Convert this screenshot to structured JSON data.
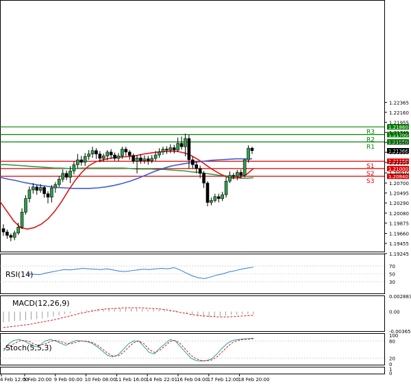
{
  "chart_data": {
    "type": "candlestick",
    "main": {
      "ylim": [
        1.193,
        1.2445
      ],
      "ticks": [
        "1.22365",
        "1.22160",
        "1.21955",
        "1.21745",
        "1.21540",
        "1.21335",
        "1.21125",
        "1.20910",
        "1.20700",
        "1.20495",
        "1.20290",
        "1.20080",
        "1.19875",
        "1.19660",
        "1.19455",
        "1.19245"
      ],
      "levels": [
        {
          "name": "R3",
          "value": 1.2186,
          "label": "1.21860",
          "color": "#008000"
        },
        {
          "name": "R2",
          "value": 1.217,
          "label": "1.21700",
          "color": "#008000"
        },
        {
          "name": "R1",
          "value": 1.2155,
          "label": "1.21550",
          "color": "#008000"
        },
        {
          "name": "S1",
          "value": 1.2115,
          "label": "1.21150",
          "color": "#e00000"
        },
        {
          "name": "S2",
          "value": 1.21,
          "label": "1.21000",
          "color": "#e00000"
        },
        {
          "name": "S3",
          "value": 1.2084,
          "label": "1.20840",
          "color": "#e00000"
        }
      ],
      "current": {
        "value": 1.21366,
        "label": "1.21366"
      },
      "candles": [
        [
          1.1976,
          1.1969,
          1.1985,
          1.1961
        ],
        [
          1.1969,
          1.1962,
          1.1974,
          1.1955
        ],
        [
          1.1962,
          1.1958,
          1.1966,
          1.195
        ],
        [
          1.1958,
          1.1967,
          1.1972,
          1.1952
        ],
        [
          1.1967,
          1.1979,
          1.1988,
          1.1963
        ],
        [
          1.1979,
          1.201,
          1.2018,
          1.1975
        ],
        [
          1.201,
          1.2038,
          1.2045,
          1.2005
        ],
        [
          1.2038,
          1.2056,
          1.2063,
          1.203
        ],
        [
          1.2056,
          1.2062,
          1.207,
          1.2048
        ],
        [
          1.2062,
          1.2055,
          1.2066,
          1.2046
        ],
        [
          1.2055,
          1.2061,
          1.2068,
          1.205
        ],
        [
          1.2061,
          1.2048,
          1.2064,
          1.204
        ],
        [
          1.2048,
          1.2041,
          1.2053,
          1.2028
        ],
        [
          1.2041,
          1.206,
          1.2066,
          1.203
        ],
        [
          1.206,
          1.2067,
          1.2072,
          1.205
        ],
        [
          1.2067,
          1.2078,
          1.2085,
          1.2062
        ],
        [
          1.2078,
          1.209,
          1.2098,
          1.2072
        ],
        [
          1.209,
          1.2082,
          1.2096,
          1.2076
        ],
        [
          1.2082,
          1.2095,
          1.2105,
          1.207
        ],
        [
          1.2095,
          1.2108,
          1.2115,
          1.2088
        ],
        [
          1.2108,
          1.2118,
          1.213,
          1.21
        ],
        [
          1.2118,
          1.2113,
          1.2126,
          1.2106
        ],
        [
          1.2113,
          1.2125,
          1.2132,
          1.2105
        ],
        [
          1.2125,
          1.213,
          1.2138,
          1.2118
        ],
        [
          1.213,
          1.2137,
          1.2145,
          1.2122
        ],
        [
          1.2137,
          1.213,
          1.2142,
          1.212
        ],
        [
          1.213,
          1.2121,
          1.2136,
          1.2113
        ],
        [
          1.2121,
          1.2126,
          1.2131,
          1.2114
        ],
        [
          1.2126,
          1.2134,
          1.2138,
          1.2117
        ],
        [
          1.2134,
          1.2128,
          1.214,
          1.212
        ],
        [
          1.2128,
          1.2121,
          1.2133,
          1.2116
        ],
        [
          1.2121,
          1.2126,
          1.2132,
          1.2115
        ],
        [
          1.2126,
          1.214,
          1.2145,
          1.212
        ],
        [
          1.214,
          1.2134,
          1.2145,
          1.2126
        ],
        [
          1.2134,
          1.2127,
          1.2138,
          1.2118
        ],
        [
          1.2127,
          1.2115,
          1.2131,
          1.211
        ],
        [
          1.2115,
          1.2122,
          1.2128,
          1.209
        ],
        [
          1.2122,
          1.2116,
          1.213,
          1.211
        ],
        [
          1.2116,
          1.212,
          1.2127,
          1.211
        ],
        [
          1.212,
          1.2116,
          1.2126,
          1.2108
        ],
        [
          1.2116,
          1.2121,
          1.2128,
          1.2111
        ],
        [
          1.2121,
          1.2128,
          1.2136,
          1.2116
        ],
        [
          1.2128,
          1.2134,
          1.2142,
          1.2122
        ],
        [
          1.2134,
          1.214,
          1.2145,
          1.2128
        ],
        [
          1.214,
          1.2138,
          1.2146,
          1.213
        ],
        [
          1.2138,
          1.2143,
          1.215,
          1.2132
        ],
        [
          1.2143,
          1.2138,
          1.2149,
          1.2131
        ],
        [
          1.2138,
          1.2152,
          1.2164,
          1.2134
        ],
        [
          1.2152,
          1.2145,
          1.2166,
          1.2139
        ],
        [
          1.2145,
          1.2162,
          1.2172,
          1.2125
        ],
        [
          1.2162,
          1.2118,
          1.217,
          1.21
        ],
        [
          1.2118,
          1.2108,
          1.2125,
          1.21
        ],
        [
          1.2108,
          1.21,
          1.2114,
          1.209
        ],
        [
          1.21,
          1.209,
          1.2106,
          1.208
        ],
        [
          1.209,
          1.207,
          1.2095,
          1.206
        ],
        [
          1.207,
          1.203,
          1.2074,
          1.2022
        ],
        [
          1.203,
          1.2034,
          1.204,
          1.2024
        ],
        [
          1.2034,
          1.2042,
          1.2048,
          1.203
        ],
        [
          1.2042,
          1.2038,
          1.2048,
          1.203
        ],
        [
          1.2038,
          1.2046,
          1.2052,
          1.2033
        ],
        [
          1.2046,
          1.2074,
          1.2082,
          1.204
        ],
        [
          1.2074,
          1.2086,
          1.2094,
          1.207
        ],
        [
          1.2086,
          1.2084,
          1.2091,
          1.2078
        ],
        [
          1.2084,
          1.2092,
          1.2097,
          1.2076
        ],
        [
          1.2092,
          1.2086,
          1.2098,
          1.208
        ],
        [
          1.2086,
          1.2118,
          1.212,
          1.2082
        ],
        [
          1.2118,
          1.2142,
          1.2148,
          1.2112
        ],
        [
          1.2142,
          1.2137,
          1.2145,
          1.213
        ]
      ],
      "ma_blue": [
        1.2082,
        1.2078,
        1.2075,
        1.2071,
        1.2068,
        1.2065,
        1.2063,
        1.2061,
        1.206,
        1.2059,
        1.2059,
        1.2059,
        1.206,
        1.2062,
        1.2065,
        1.2069,
        1.2074,
        1.208,
        1.2087,
        1.2094,
        1.21,
        1.2105,
        1.2108,
        1.2111,
        1.2113,
        1.2115,
        1.2117,
        1.2118,
        1.2119,
        1.212,
        1.212,
        1.212
      ],
      "ma_green": [
        1.2108,
        1.2108,
        1.2107,
        1.2106,
        1.2105,
        1.2104,
        1.2103,
        1.2102,
        1.2101,
        1.2101,
        1.21,
        1.21,
        1.2101,
        1.2101,
        1.2101,
        1.2101,
        1.2101,
        1.2101,
        1.2101,
        1.21,
        1.2099,
        1.2099,
        1.2099,
        1.2098,
        1.2098,
        1.2097,
        1.2096,
        1.2095,
        1.2093,
        1.2092,
        1.209,
        1.2088,
        1.2086,
        1.2085,
        1.2082,
        1.208,
        1.208,
        1.2081
      ],
      "ma_red": [
        1.2032,
        1.2012,
        1.1992,
        1.1978,
        1.1975,
        1.1978,
        1.1985,
        1.1996,
        1.2012,
        1.2032,
        1.2055,
        1.2076,
        1.2093,
        1.2106,
        1.2114,
        1.2118,
        1.2121,
        1.2123,
        1.2124,
        1.2125,
        1.2127,
        1.213,
        1.2132,
        1.2134,
        1.2135,
        1.2136,
        1.2135,
        1.2132,
        1.2126,
        1.2118,
        1.2108,
        1.2098,
        1.209,
        1.2083,
        1.208,
        1.2082,
        1.2088,
        1.21
      ]
    },
    "rsi": {
      "label": "RSI(14)",
      "ylim": [
        0,
        100
      ],
      "ticks": [
        "70",
        "50",
        "30"
      ],
      "values": [
        50,
        49,
        48,
        52,
        55,
        58,
        61,
        60,
        62,
        64,
        63,
        62,
        61,
        63,
        60,
        57,
        56,
        58,
        60,
        62,
        61,
        63,
        64,
        63,
        66,
        60,
        52,
        45,
        40,
        38,
        42,
        47,
        50,
        55,
        58,
        62,
        65,
        67
      ]
    },
    "macd": {
      "label": "MACD(12,26,9)",
      "ylim": [
        -0.003654,
        0.002883
      ],
      "ticks": [
        "0.002883",
        "0.00",
        "-0.003654"
      ],
      "histogram": [
        -0.002,
        -0.0019,
        -0.0018,
        -0.0017,
        -0.0016,
        -0.0015,
        -0.0014,
        -0.0013,
        -0.0011,
        -0.0009,
        -0.0007,
        -0.0005,
        -0.0003,
        -0.0001,
        0.0001,
        0.0003,
        0.0004,
        0.0005,
        0.0005,
        0.0006,
        0.0006,
        0.0006,
        0.0006,
        0.0006,
        0.0006,
        0.0005,
        0.0004,
        0.0004,
        0.0004,
        0.0004,
        0.0003,
        0.0002,
        0.0,
        -0.0003,
        -0.0006,
        -0.0009,
        -0.001,
        -0.001,
        -0.0009,
        -0.0008,
        -0.0007,
        -0.0006,
        -0.0006,
        -0.0005,
        -0.0005,
        -0.0005
      ],
      "signal": [
        -0.003,
        -0.0028,
        -0.0026,
        -0.0024,
        -0.0021,
        -0.0018,
        -0.0015,
        -0.0011,
        -0.0007,
        -0.0003,
        0.0,
        0.0003,
        0.0005,
        0.0006,
        0.0007,
        0.0007,
        0.0007,
        0.0006,
        0.0005,
        0.0003,
        0.0,
        -0.0003,
        -0.0006,
        -0.0008,
        -0.0009,
        -0.001,
        -0.001,
        -0.0009,
        -0.0008,
        -0.0007
      ]
    },
    "stoch": {
      "label": "Stoch(5,5,3)",
      "ylim": [
        0,
        100
      ],
      "ticks": [
        "100",
        "80",
        "20",
        "0"
      ],
      "main": [
        45,
        70,
        82,
        85,
        80,
        70,
        60,
        65,
        80,
        85,
        80,
        72,
        65,
        75,
        82,
        80,
        78,
        72,
        60,
        45,
        30,
        25,
        32,
        50,
        70,
        80,
        80,
        60,
        40,
        35,
        55,
        70,
        85,
        80,
        60,
        40,
        20,
        12,
        10,
        12,
        18,
        35,
        55,
        72,
        82,
        85,
        87,
        88,
        90
      ],
      "signal": [
        52,
        60,
        70,
        80,
        82,
        78,
        68,
        65,
        70,
        78,
        82,
        78,
        72,
        70,
        76,
        80,
        79,
        75,
        66,
        52,
        38,
        28,
        28,
        40,
        58,
        74,
        80,
        70,
        50,
        40,
        48,
        62,
        78,
        82,
        70,
        50,
        30,
        18,
        12,
        11,
        14,
        25,
        42,
        60,
        75,
        82,
        85,
        86,
        88
      ]
    },
    "x_ticks": [
      "4 Feb 12:00",
      "5 Feb 20:00",
      "9 Feb 00:00",
      "10 Feb 08:00",
      "11 Feb 16:00",
      "14 Feb 22:01",
      "16 Feb 04:00",
      "17 Feb 12:00",
      "18 Feb 20:00"
    ]
  }
}
